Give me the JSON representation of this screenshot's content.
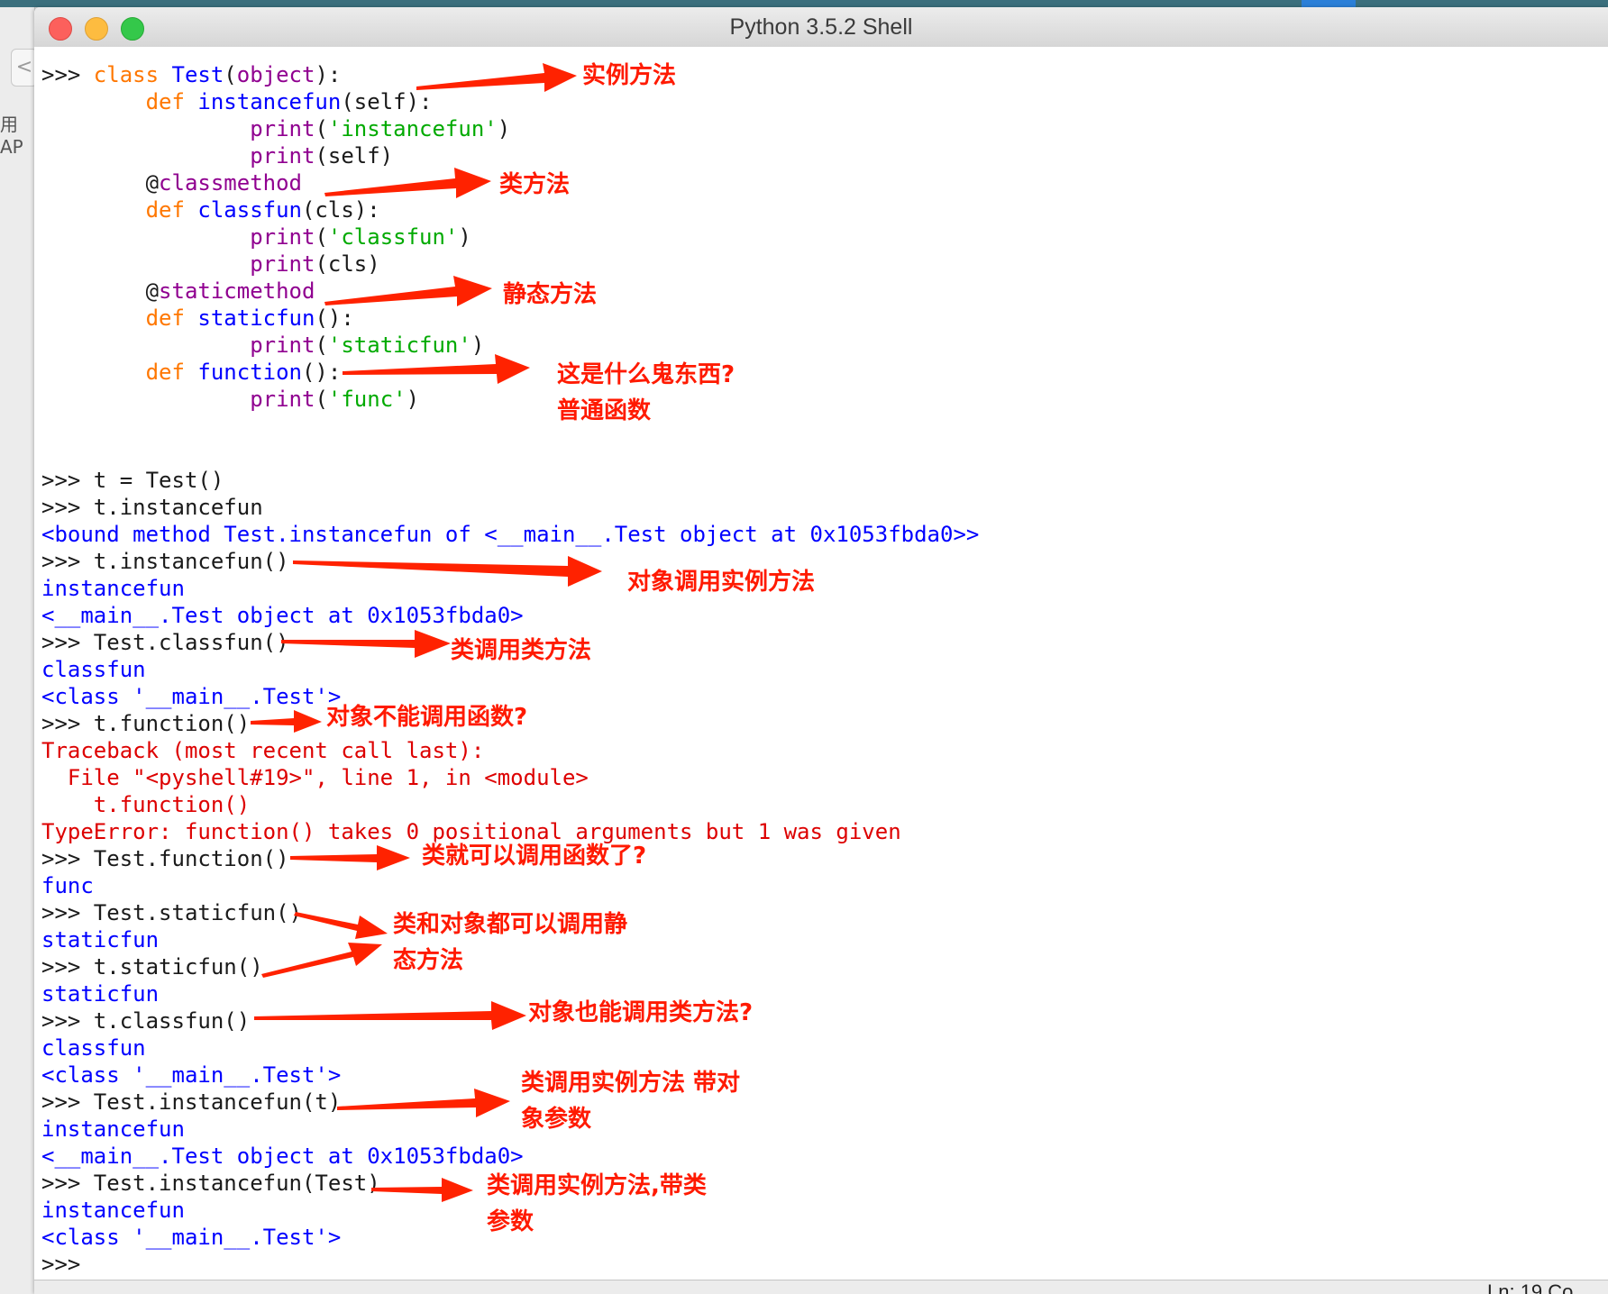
{
  "window": {
    "title": "Python 3.5.2 Shell"
  },
  "background": {
    "back_glyph": "<",
    "cut_text": "用AP"
  },
  "status": {
    "line_col": "Ln: 19   Co"
  },
  "lines": [
    [
      [
        "c-prompt",
        ">>> "
      ],
      [
        "c-kw",
        "class "
      ],
      [
        "c-def",
        "Test"
      ],
      [
        "c-plain",
        "("
      ],
      [
        "c-builtin",
        "object"
      ],
      [
        "c-plain",
        "):"
      ]
    ],
    [
      [
        "c-plain",
        "        "
      ],
      [
        "c-kw",
        "def "
      ],
      [
        "c-def",
        "instancefun"
      ],
      [
        "c-plain",
        "(self):"
      ]
    ],
    [
      [
        "c-plain",
        "                "
      ],
      [
        "c-builtin",
        "print"
      ],
      [
        "c-plain",
        "("
      ],
      [
        "c-str",
        "'instancefun'"
      ],
      [
        "c-plain",
        ")"
      ]
    ],
    [
      [
        "c-plain",
        "                "
      ],
      [
        "c-builtin",
        "print"
      ],
      [
        "c-plain",
        "(self)"
      ]
    ],
    [
      [
        "c-plain",
        "        @"
      ],
      [
        "c-builtin",
        "classmethod"
      ]
    ],
    [
      [
        "c-plain",
        "        "
      ],
      [
        "c-kw",
        "def "
      ],
      [
        "c-def",
        "classfun"
      ],
      [
        "c-plain",
        "(cls):"
      ]
    ],
    [
      [
        "c-plain",
        "                "
      ],
      [
        "c-builtin",
        "print"
      ],
      [
        "c-plain",
        "("
      ],
      [
        "c-str",
        "'classfun'"
      ],
      [
        "c-plain",
        ")"
      ]
    ],
    [
      [
        "c-plain",
        "                "
      ],
      [
        "c-builtin",
        "print"
      ],
      [
        "c-plain",
        "(cls)"
      ]
    ],
    [
      [
        "c-plain",
        "        @"
      ],
      [
        "c-builtin",
        "staticmethod"
      ]
    ],
    [
      [
        "c-plain",
        "        "
      ],
      [
        "c-kw",
        "def "
      ],
      [
        "c-def",
        "staticfun"
      ],
      [
        "c-plain",
        "():"
      ]
    ],
    [
      [
        "c-plain",
        "                "
      ],
      [
        "c-builtin",
        "print"
      ],
      [
        "c-plain",
        "("
      ],
      [
        "c-str",
        "'staticfun'"
      ],
      [
        "c-plain",
        ")"
      ]
    ],
    [
      [
        "c-plain",
        "        "
      ],
      [
        "c-kw",
        "def "
      ],
      [
        "c-def",
        "function"
      ],
      [
        "c-plain",
        "():"
      ]
    ],
    [
      [
        "c-plain",
        "                "
      ],
      [
        "c-builtin",
        "print"
      ],
      [
        "c-plain",
        "("
      ],
      [
        "c-str",
        "'func'"
      ],
      [
        "c-plain",
        ")"
      ]
    ],
    [],
    [],
    [
      [
        "c-prompt",
        ">>> "
      ],
      [
        "c-plain",
        "t = Test()"
      ]
    ],
    [
      [
        "c-prompt",
        ">>> "
      ],
      [
        "c-plain",
        "t.instancefun"
      ]
    ],
    [
      [
        "c-out",
        "<bound method Test.instancefun of <__main__.Test object at 0x1053fbda0>>"
      ]
    ],
    [
      [
        "c-prompt",
        ">>> "
      ],
      [
        "c-plain",
        "t.instancefun()"
      ]
    ],
    [
      [
        "c-out",
        "instancefun"
      ]
    ],
    [
      [
        "c-out",
        "<__main__.Test object at 0x1053fbda0>"
      ]
    ],
    [
      [
        "c-prompt",
        ">>> "
      ],
      [
        "c-plain",
        "Test.classfun()"
      ]
    ],
    [
      [
        "c-out",
        "classfun"
      ]
    ],
    [
      [
        "c-out",
        "<class '__main__.Test'>"
      ]
    ],
    [
      [
        "c-prompt",
        ">>> "
      ],
      [
        "c-plain",
        "t.function()"
      ]
    ],
    [
      [
        "c-err",
        "Traceback (most recent call last):"
      ]
    ],
    [
      [
        "c-err",
        "  File \"<pyshell#19>\", line 1, in <module>"
      ]
    ],
    [
      [
        "c-err",
        "    t.function()"
      ]
    ],
    [
      [
        "c-err",
        "TypeError: function() takes 0 positional arguments but 1 was given"
      ]
    ],
    [
      [
        "c-prompt",
        ">>> "
      ],
      [
        "c-plain",
        "Test.function()"
      ]
    ],
    [
      [
        "c-out",
        "func"
      ]
    ],
    [
      [
        "c-prompt",
        ">>> "
      ],
      [
        "c-plain",
        "Test.staticfun()"
      ]
    ],
    [
      [
        "c-out",
        "staticfun"
      ]
    ],
    [
      [
        "c-prompt",
        ">>> "
      ],
      [
        "c-plain",
        "t.staticfun()"
      ]
    ],
    [
      [
        "c-out",
        "staticfun"
      ]
    ],
    [
      [
        "c-prompt",
        ">>> "
      ],
      [
        "c-plain",
        "t.classfun()"
      ]
    ],
    [
      [
        "c-out",
        "classfun"
      ]
    ],
    [
      [
        "c-out",
        "<class '__main__.Test'>"
      ]
    ],
    [
      [
        "c-prompt",
        ">>> "
      ],
      [
        "c-plain",
        "Test.instancefun(t)"
      ]
    ],
    [
      [
        "c-out",
        "instancefun"
      ]
    ],
    [
      [
        "c-out",
        "<__main__.Test object at 0x1053fbda0>"
      ]
    ],
    [
      [
        "c-prompt",
        ">>> "
      ],
      [
        "c-plain",
        "Test.instancefun(Test)"
      ]
    ],
    [
      [
        "c-out",
        "instancefun"
      ]
    ],
    [
      [
        "c-out",
        "<class '__main__.Test'>"
      ]
    ],
    [
      [
        "c-prompt",
        ">>> "
      ]
    ]
  ],
  "annotations": {
    "a1": "实例方法",
    "a2": "类方法",
    "a3": "静态方法",
    "a4a": "这是什么鬼东西?",
    "a4b": "普通函数",
    "a5": "对象调用实例方法",
    "a6": "类调用类方法",
    "a7": "对象不能调用函数?",
    "a8": "类就可以调用函数了?",
    "a9a": "类和对象都可以调用静",
    "a9b": "态方法",
    "a10": "对象也能调用类方法?",
    "a11a": "类调用实例方法 带对",
    "a11b": "象参数",
    "a12a": "类调用实例方法,带类",
    "a12b": "参数"
  },
  "colors": {
    "keyword": "#ff7700",
    "definition": "#0000ff",
    "builtin": "#900090",
    "string": "#00aa00",
    "output": "#0000ff",
    "error": "#dd0000",
    "annotation": "#ff1a00"
  }
}
